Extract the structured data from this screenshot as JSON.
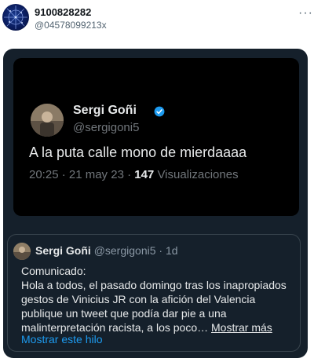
{
  "header": {
    "display_name": "9100828282",
    "handle": "@04578099213x",
    "more_icon": "···"
  },
  "screenshot_tweet": {
    "name": "Sergi Goñi",
    "handle": "@sergigoni5",
    "text": "A la puta calle mono de mierdaaaa",
    "time": "20:25 · 21 may 23 · ",
    "views_count": "147",
    "views_label": " Visualizaciones",
    "verified_color": "#1d9bf0"
  },
  "quoted_tweet": {
    "name": "Sergi Goñi",
    "handle": "@sergigoni5",
    "sep": " · ",
    "time": "1d",
    "body": "Comunicado:\nHola a todos, el pasado domingo tras los inapropiados gestos de Vinicius JR con la afición del Valencia publique un tweet que podía dar pie a una malinterpretación racista, a los poco…",
    "show_more": "Mostrar más",
    "show_thread": "Mostrar este hilo"
  },
  "colors": {
    "card_bg": "#15202b",
    "accent": "#1d9bf0"
  }
}
